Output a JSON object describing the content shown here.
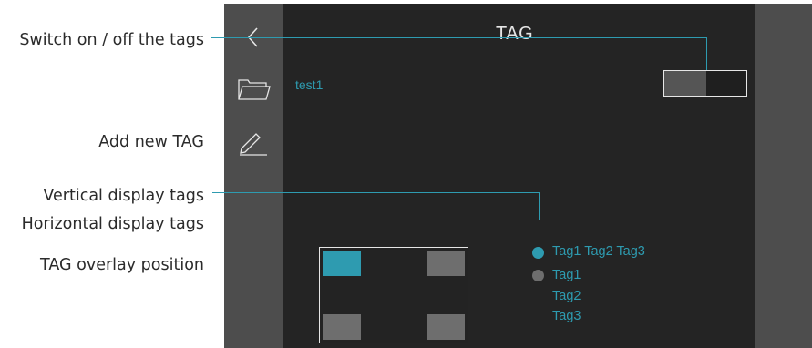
{
  "annotations": {
    "switch_tags": "Switch on / off the tags",
    "add_tag": "Add new TAG",
    "vertical_tags": "Vertical display tags",
    "horizontal_tags": "Horizontal display tags",
    "overlay_position": "TAG overlay position"
  },
  "header": {
    "title": "TAG"
  },
  "folder": {
    "name": "test1"
  },
  "toggle": {
    "state": "off"
  },
  "display_options": {
    "horizontal": {
      "label": "Tag1 Tag2 Tag3",
      "selected": true
    },
    "vertical": {
      "labels": [
        "Tag1",
        "Tag2",
        "Tag3"
      ],
      "selected": false
    }
  },
  "overlay_position": {
    "selected": "top-left",
    "options": [
      "top-left",
      "top-right",
      "bottom-left",
      "bottom-right"
    ]
  },
  "colors": {
    "accent": "#2e9bb0",
    "screen_bg": "#242424",
    "sidebar_bg": "#4d4d4d",
    "inactive": "#6e6e6e",
    "text_light": "#e6e6e6"
  },
  "icons": {
    "back": "chevron-left-icon",
    "folder": "folder-icon",
    "edit": "pencil-icon"
  }
}
